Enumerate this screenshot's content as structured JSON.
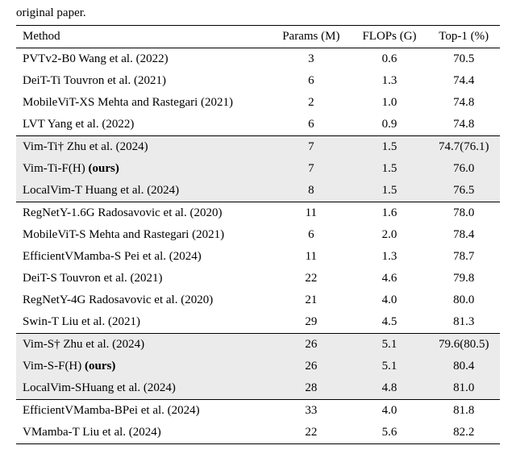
{
  "pre_text": "original paper.",
  "headers": {
    "method": "Method",
    "params": "Params (M)",
    "flops": "FLOPs (G)",
    "top1": "Top-1 (%)"
  },
  "chart_data": {
    "type": "table",
    "columns": [
      "Method",
      "Params (M)",
      "FLOPs (G)",
      "Top-1 (%)"
    ],
    "rows": [
      {
        "method": "PVTv2-B0 Wang et al. (2022)",
        "params": "3",
        "flops": "0.6",
        "top1": "70.5",
        "shaded": false,
        "ours": false
      },
      {
        "method": "DeiT-Ti Touvron et al. (2021)",
        "params": "6",
        "flops": "1.3",
        "top1": "74.4",
        "shaded": false,
        "ours": false
      },
      {
        "method": "MobileViT-XS Mehta and Rastegari (2021)",
        "params": "2",
        "flops": "1.0",
        "top1": "74.8",
        "shaded": false,
        "ours": false
      },
      {
        "method": "LVT Yang et al. (2022)",
        "params": "6",
        "flops": "0.9",
        "top1": "74.8",
        "shaded": false,
        "ours": false
      },
      {
        "method": "Vim-Ti† Zhu et al. (2024)",
        "params": "7",
        "flops": "1.5",
        "top1": "74.7(76.1)",
        "shaded": true,
        "ours": false
      },
      {
        "method": "Vim-Ti-F(H) (ours)",
        "params": "7",
        "flops": "1.5",
        "top1": "76.0",
        "shaded": true,
        "ours": true
      },
      {
        "method": "LocalVim-T Huang et al. (2024)",
        "params": "8",
        "flops": "1.5",
        "top1": "76.5",
        "shaded": true,
        "ours": false
      },
      {
        "method": "RegNetY-1.6G Radosavovic et al. (2020)",
        "params": "11",
        "flops": "1.6",
        "top1": "78.0",
        "shaded": false,
        "ours": false
      },
      {
        "method": "MobileViT-S Mehta and Rastegari (2021)",
        "params": "6",
        "flops": "2.0",
        "top1": "78.4",
        "shaded": false,
        "ours": false
      },
      {
        "method": "EfficientVMamba-S Pei et al. (2024)",
        "params": "11",
        "flops": "1.3",
        "top1": "78.7",
        "shaded": false,
        "ours": false
      },
      {
        "method": "DeiT-S Touvron et al. (2021)",
        "params": "22",
        "flops": "4.6",
        "top1": "79.8",
        "shaded": false,
        "ours": false
      },
      {
        "method": "RegNetY-4G Radosavovic et al. (2020)",
        "params": "21",
        "flops": "4.0",
        "top1": "80.0",
        "shaded": false,
        "ours": false
      },
      {
        "method": "Swin-T Liu et al. (2021)",
        "params": "29",
        "flops": "4.5",
        "top1": "81.3",
        "shaded": false,
        "ours": false
      },
      {
        "method": "Vim-S† Zhu et al. (2024)",
        "params": "26",
        "flops": "5.1",
        "top1": "79.6(80.5)",
        "shaded": true,
        "ours": false
      },
      {
        "method": "Vim-S-F(H)  (ours)",
        "params": "26",
        "flops": "5.1",
        "top1": "80.4",
        "shaded": true,
        "ours": true
      },
      {
        "method": "LocalVim-SHuang et al. (2024)",
        "params": "28",
        "flops": "4.8",
        "top1": "81.0",
        "shaded": true,
        "ours": false
      },
      {
        "method": "EfficientVMamba-BPei et al. (2024)",
        "params": "33",
        "flops": "4.0",
        "top1": "81.8",
        "shaded": false,
        "ours": false
      },
      {
        "method": "VMamba-T Liu et al. (2024)",
        "params": "22",
        "flops": "5.6",
        "top1": "82.2",
        "shaded": false,
        "ours": false
      }
    ]
  }
}
